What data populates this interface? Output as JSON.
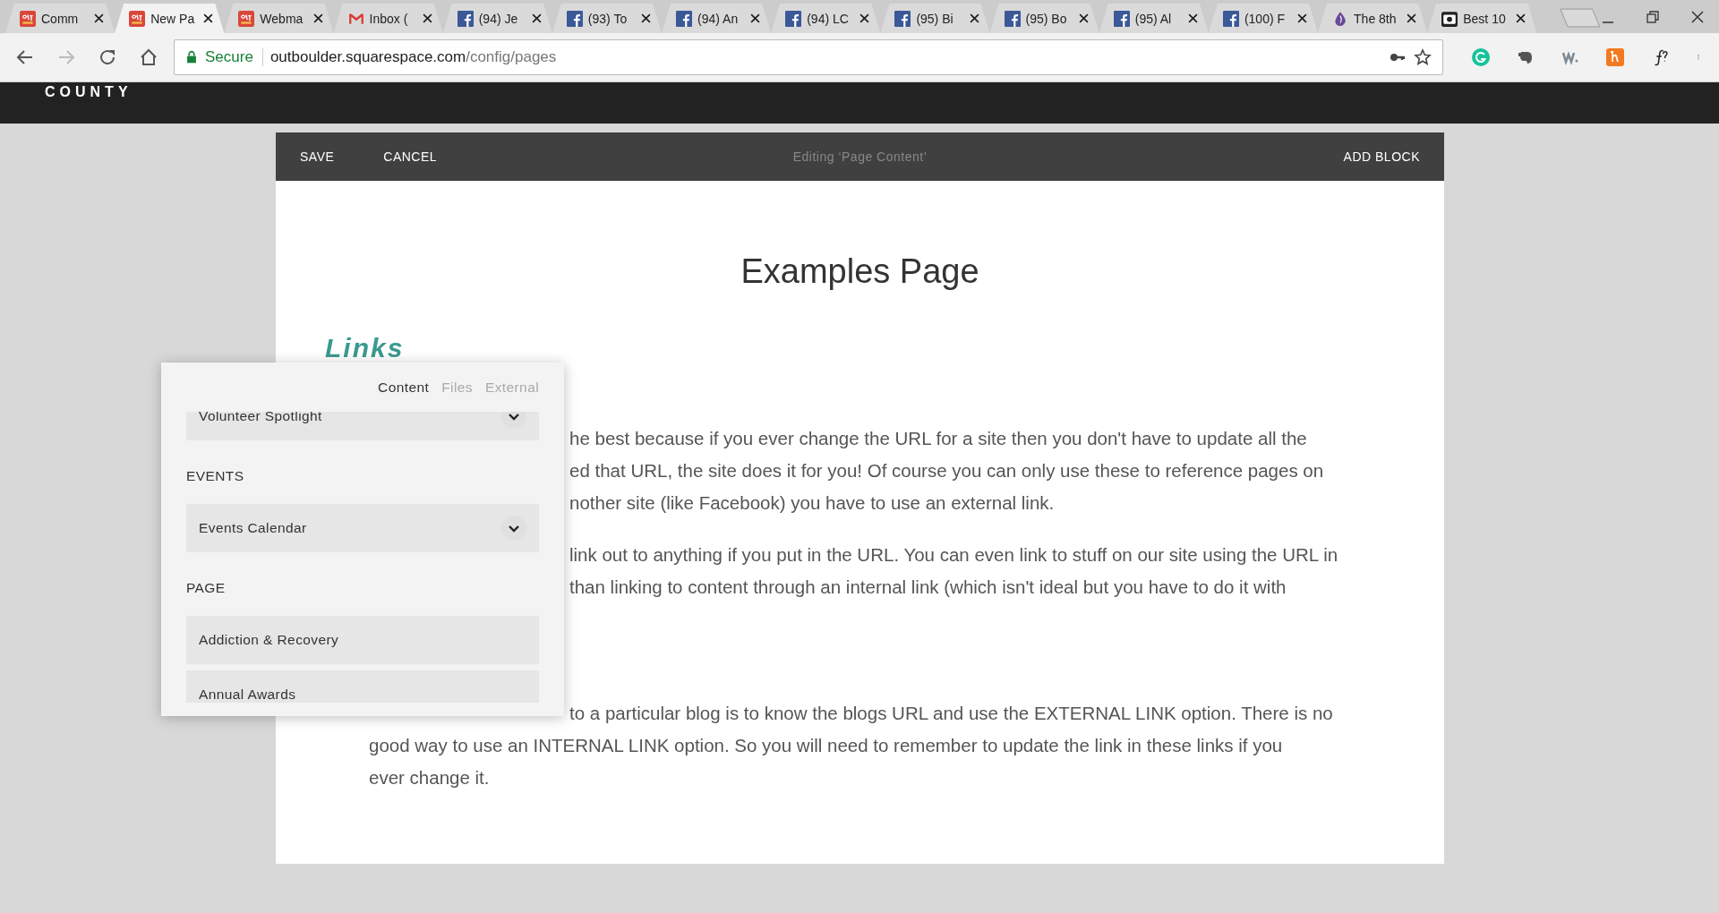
{
  "browser": {
    "tabs": [
      {
        "title": "Comm",
        "kind": "logo",
        "selected": false
      },
      {
        "title": "New Pa",
        "kind": "logo",
        "selected": true
      },
      {
        "title": "Webma",
        "kind": "logo",
        "selected": false
      },
      {
        "title": "Inbox (",
        "kind": "mail",
        "selected": false
      },
      {
        "title": "(94) Je",
        "kind": "facebook",
        "selected": false
      },
      {
        "title": "(93) To",
        "kind": "facebook",
        "selected": false
      },
      {
        "title": "(94) An",
        "kind": "facebook",
        "selected": false
      },
      {
        "title": "(94) LC",
        "kind": "facebook",
        "selected": false
      },
      {
        "title": "(95) Bi",
        "kind": "facebook",
        "selected": false
      },
      {
        "title": "(95) Bo",
        "kind": "facebook",
        "selected": false
      },
      {
        "title": "(95) Al",
        "kind": "facebook",
        "selected": false
      },
      {
        "title": "(100) F",
        "kind": "facebook",
        "selected": false
      },
      {
        "title": "The 8th",
        "kind": "drop",
        "selected": false
      },
      {
        "title": "Best 10",
        "kind": "camera",
        "selected": false
      }
    ],
    "secure_label": "Secure",
    "url_host": "outboulder.squarespace.com",
    "url_path": "/config/pages"
  },
  "site_header": {
    "brand": "COUNTY"
  },
  "editor": {
    "save": "SAVE",
    "cancel": "CANCEL",
    "status": "Editing ‘Page Content’",
    "add_block": "ADD BLOCK",
    "title": "Examples Page",
    "heading": "Links",
    "paragraphs": [
      {
        "lines": [
          {
            "text": "he best because if you ever change the URL for a site then you don't have to update all the",
            "kind": "partial"
          },
          {
            "text": "ed that URL, the site does it for you! Of course you can only use these to reference pages on",
            "kind": "partial"
          },
          {
            "text": "nother site (like Facebook) you have to use an external link.",
            "kind": "partial"
          }
        ]
      },
      {
        "lines": [
          {
            "text": "link out to anything if you put in the URL. You can even link to stuff on our site using the URL in",
            "kind": "partial"
          },
          {
            "text": "than linking to content through an internal link (which isn't ideal but you have to do it with",
            "kind": "partial"
          }
        ]
      },
      {
        "lines": [
          {
            "text": "to a particular blog is to know the blogs URL and use the EXTERNAL LINK option. There is no",
            "kind": "partial"
          },
          {
            "text": "good way to use an INTERNAL LINK option. So you will need to remember to update the link in these links if you",
            "kind": "full"
          },
          {
            "text": "ever change it.",
            "kind": "full"
          }
        ]
      }
    ]
  },
  "link_picker": {
    "tabs": [
      {
        "label": "Content",
        "selected": true
      },
      {
        "label": "Files",
        "selected": false
      },
      {
        "label": "External",
        "selected": false
      }
    ],
    "items": [
      {
        "kind": "item",
        "label": "Volunteer Spotlight",
        "expandable": true
      },
      {
        "kind": "heading",
        "label": "EVENTS"
      },
      {
        "kind": "item",
        "label": "Events Calendar",
        "expandable": true
      },
      {
        "kind": "heading",
        "label": "PAGE"
      },
      {
        "kind": "item",
        "label": "Addiction & Recovery",
        "expandable": false
      },
      {
        "kind": "item",
        "label": "Annual Awards",
        "expandable": false
      }
    ]
  }
}
